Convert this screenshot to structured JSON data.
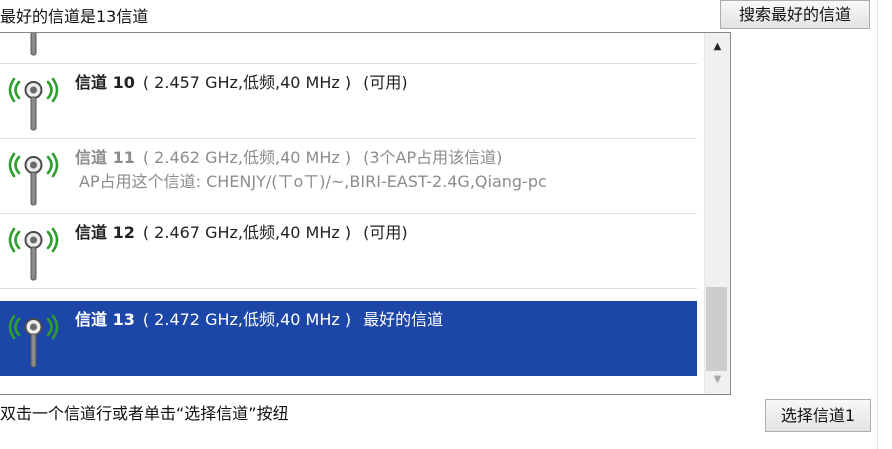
{
  "header": {
    "best_channel_label": "最好的信道是13信道",
    "search_button": "搜索最好的信道"
  },
  "channels": [
    {
      "name": "信道 10",
      "spec": "( 2.457 GHz,低频,40 MHz )",
      "status": "(可用)",
      "detail": "",
      "state": "available"
    },
    {
      "name": "信道 11",
      "spec": "( 2.462 GHz,低频,40 MHz )",
      "status": "(3个AP占用该信道)",
      "detail": "AP占用这个信道: CHENJY/(ㄒoㄒ)/~,BIRI-EAST-2.4G,Qiang-pc",
      "state": "occupied"
    },
    {
      "name": "信道 12",
      "spec": "( 2.467 GHz,低频,40 MHz )",
      "status": "(可用)",
      "detail": "",
      "state": "available"
    },
    {
      "name": "信道 13",
      "spec": "( 2.472 GHz,低频,40 MHz )",
      "status": "最好的信道",
      "detail": "",
      "state": "selected"
    }
  ],
  "footer": {
    "hint": "双击一个信道行或者单击“选择信道”按纽",
    "select_button": "选择信道1"
  },
  "icons": {
    "scroll_up": "triangle-up",
    "scroll_down": "triangle-down",
    "channel": "wireless-antenna-icon"
  },
  "colors": {
    "selected_row_bg": "#1c47a9",
    "antenna_wave": "#2e9e2e",
    "dim_text": "#8c8c8c"
  }
}
